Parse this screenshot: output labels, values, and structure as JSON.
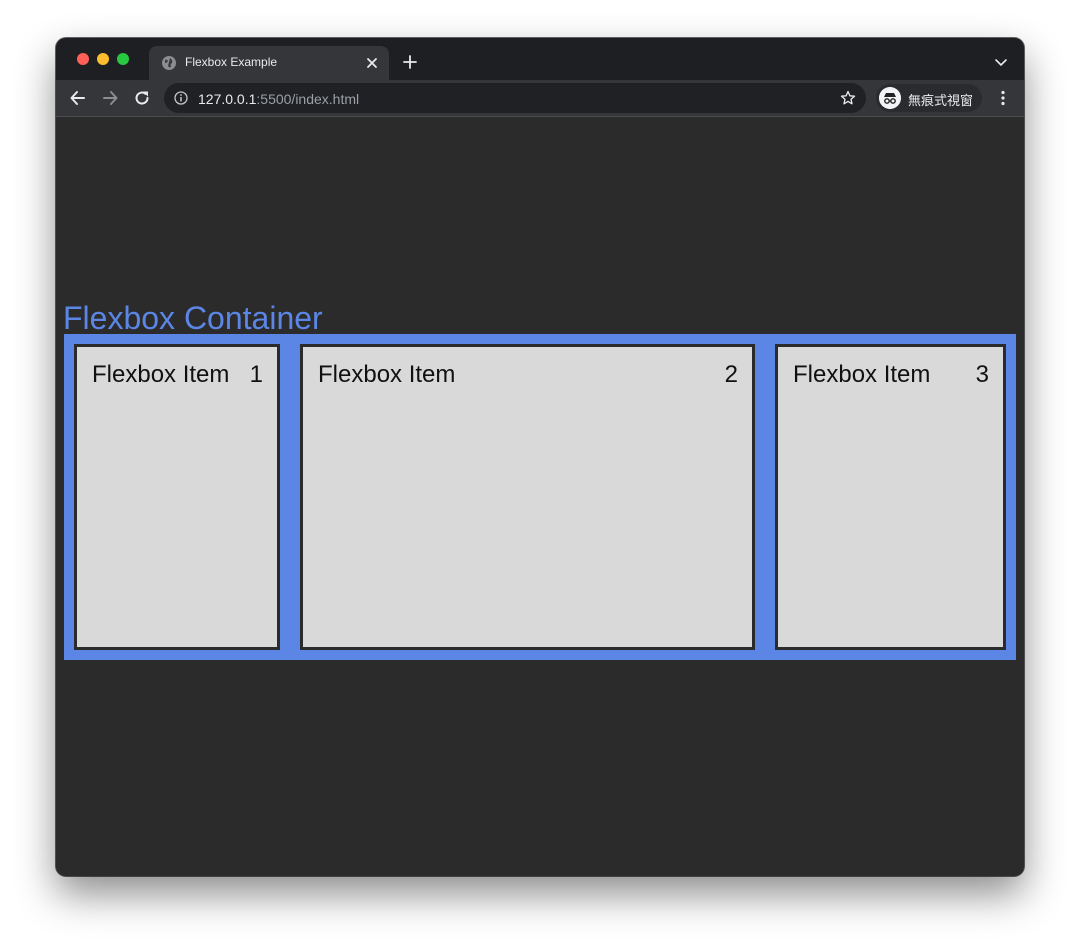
{
  "browser": {
    "tab_title": "Flexbox Example",
    "url_host": "127.0.0.1",
    "url_rest": ":5500/index.html",
    "profile_label": "無痕式視窗"
  },
  "icons": {
    "back": "arrow-left-icon",
    "forward": "arrow-right-icon",
    "reload": "reload-icon",
    "info": "info-icon",
    "star": "star-icon",
    "incognito": "incognito-icon",
    "menu": "more-vert-icon",
    "new_tab": "plus-icon",
    "tab_close": "close-icon",
    "tab_favicon": "globe-icon",
    "tab_list": "chevron-down-icon"
  },
  "colors": {
    "container": "#5b86e5",
    "item_bg": "#d9d9d9",
    "page_bg": "#2b2b2c",
    "title": "#5b86e5"
  },
  "page": {
    "container_title": "Flexbox Container",
    "items": [
      {
        "label": "Flexbox Item",
        "number": "1"
      },
      {
        "label": "Flexbox Item",
        "number": "2"
      },
      {
        "label": "Flexbox Item",
        "number": "3"
      }
    ]
  }
}
